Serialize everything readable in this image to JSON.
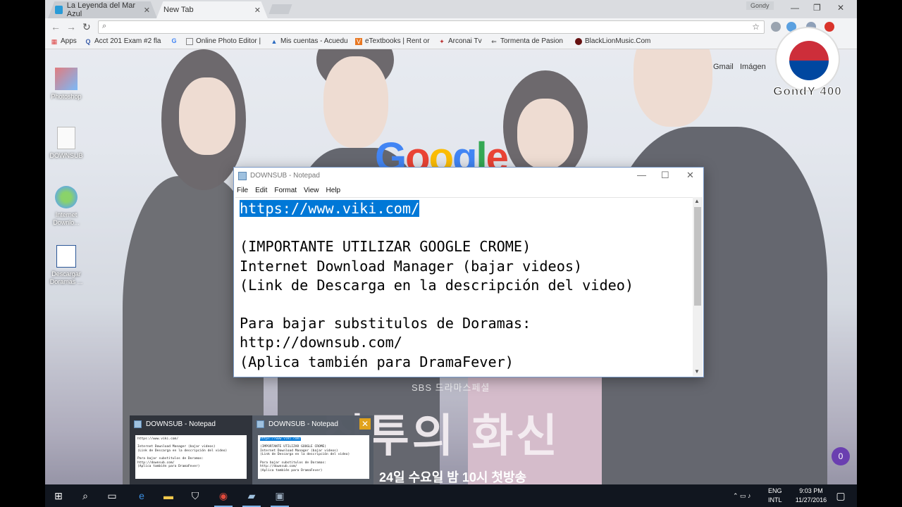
{
  "browser": {
    "tabs": [
      {
        "label": "La Leyenda del Mar Azul"
      },
      {
        "label": "New Tab"
      }
    ],
    "user_chip": "Gondy",
    "bookmarks": [
      {
        "label": "Apps",
        "icon": "apps-icon"
      },
      {
        "label": "Acct 201 Exam #2 fla",
        "icon": "quizlet-icon"
      },
      {
        "label": "G",
        "icon": "google-icon"
      },
      {
        "label": "Online Photo Editor |",
        "icon": "page-icon"
      },
      {
        "label": "Mis cuentas - Acuedu",
        "icon": "drop-icon"
      },
      {
        "label": "eTextbooks | Rent or",
        "icon": "etextbooks-icon"
      },
      {
        "label": "Arconai Tv",
        "icon": "tv-icon"
      },
      {
        "label": "Tormenta de Pasion",
        "icon": "arrow-icon"
      },
      {
        "label": "BlackLionMusic.Com",
        "icon": "music-icon"
      }
    ],
    "top_links": {
      "gmail": "Gmail",
      "images": "Imágen"
    }
  },
  "desktop_icons": [
    {
      "label": "Photoshop"
    },
    {
      "label": "DOWNSUB"
    },
    {
      "label": "Internet Downlo..."
    },
    {
      "label": "Descargar Doramas ..."
    }
  ],
  "google_logo_text": "Google",
  "google_colors": [
    "#4285f4",
    "#ea4335",
    "#fbbc05",
    "#4285f4",
    "#34a853",
    "#ea4335"
  ],
  "notepad": {
    "title": "DOWNSUB - Notepad",
    "menu": [
      "File",
      "Edit",
      "Format",
      "View",
      "Help"
    ],
    "selected_line": "https://www.viki.com/",
    "lines": [
      "",
      "(IMPORTANTE UTILIZAR GOOGLE CROME)",
      "Internet Download Manager (bajar videos)",
      "(Link de Descarga en la descripción del video)",
      "",
      "Para bajar substitulos de Doramas:",
      "http://downsub.com/",
      "(Aplica también para DramaFever)"
    ]
  },
  "poster": {
    "network": "SBS 드라마스페셜",
    "title": "질투의 화신",
    "airtime": "24일 수요일 밤 10시 첫방송"
  },
  "watermark": {
    "text": "GondY 400"
  },
  "task_previews": [
    {
      "title": "DOWNSUB - Notepad"
    },
    {
      "title": "DOWNSUB - Notepad"
    }
  ],
  "notification_count": "0",
  "taskbar": {
    "lang_top": "ENG",
    "lang_bottom": "INTL",
    "time": "9:03 PM",
    "date": "11/27/2016"
  },
  "accent": "#0078d7"
}
